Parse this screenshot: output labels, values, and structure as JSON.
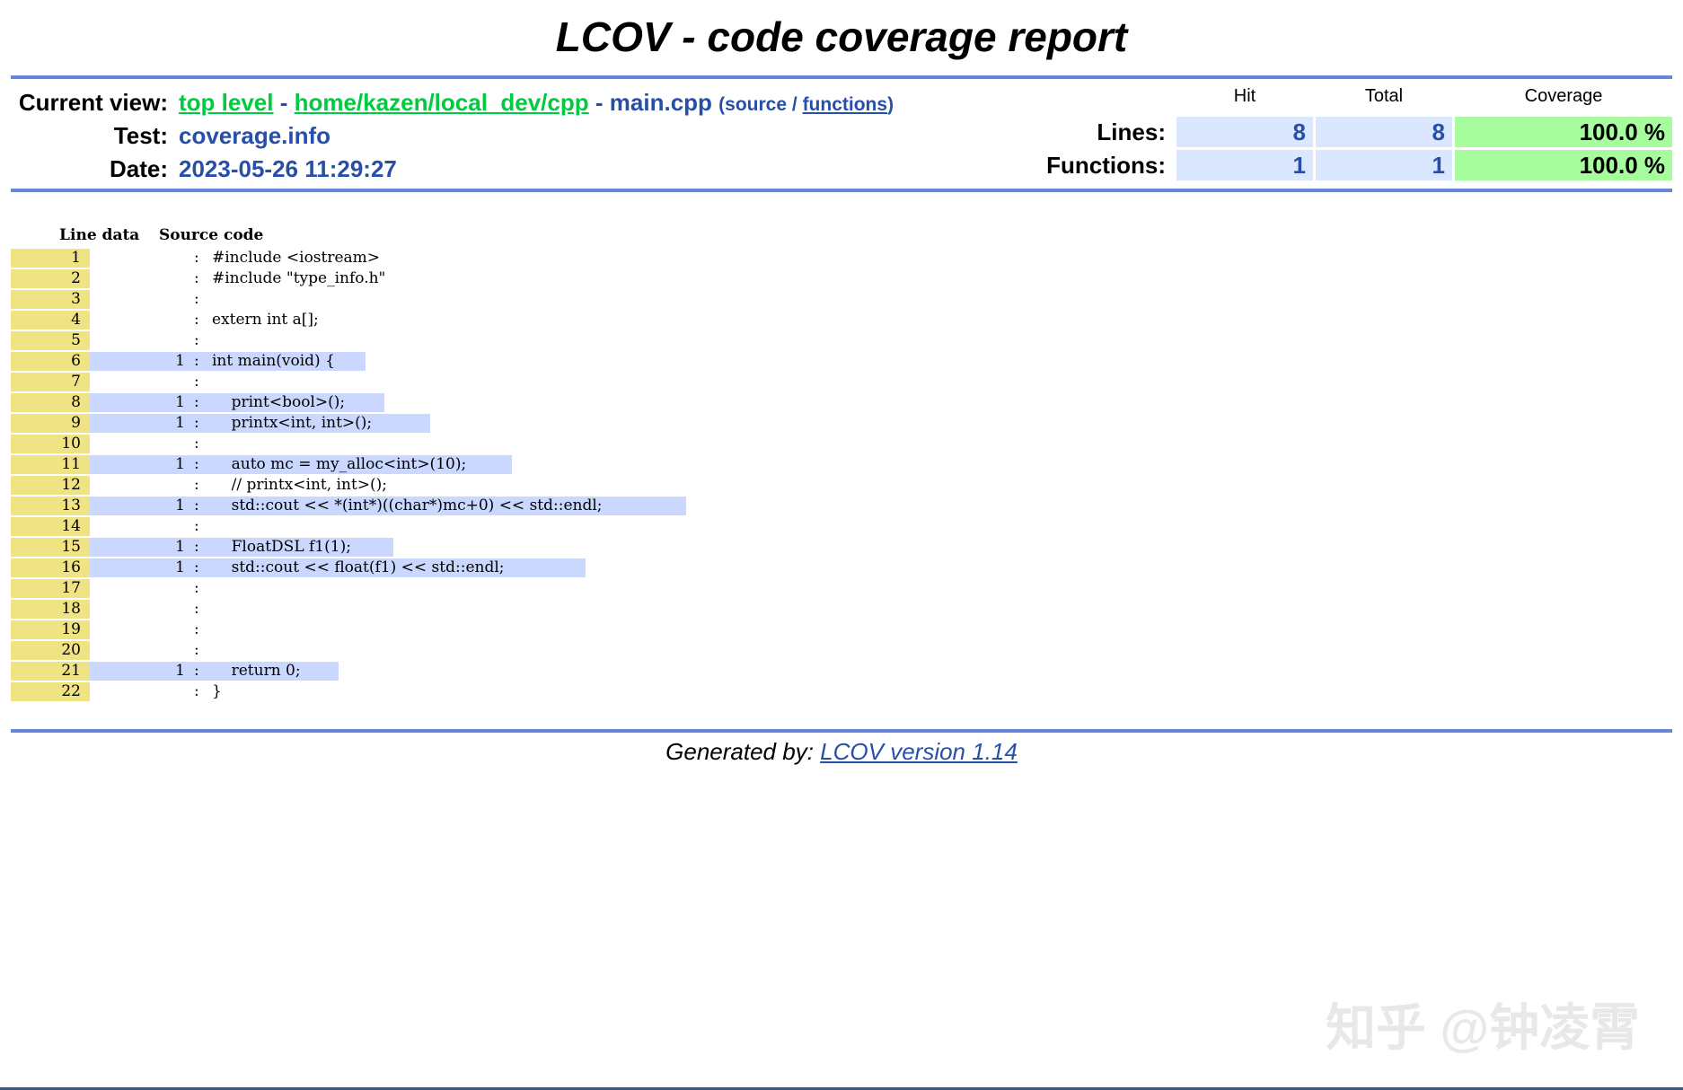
{
  "title": "LCOV - code coverage report",
  "header": {
    "current_view_label": "Current view:",
    "breadcrumb": {
      "top": "top level",
      "sep1": "-",
      "dir": "home/kazen/local_dev/cpp",
      "sep2": "-",
      "file": "main.cpp",
      "open_paren": "(",
      "source": "source",
      "slash": "/",
      "functions": "functions",
      "close_paren": ")"
    },
    "test_label": "Test:",
    "test_value": "coverage.info",
    "date_label": "Date:",
    "date_value": "2023-05-26 11:29:27",
    "columns": {
      "hit": "Hit",
      "total": "Total",
      "coverage": "Coverage"
    },
    "lines": {
      "label": "Lines:",
      "hit": "8",
      "total": "8",
      "coverage": "100.0 %"
    },
    "functions": {
      "label": "Functions:",
      "hit": "1",
      "total": "1",
      "coverage": "100.0 %"
    },
    "colors": {
      "rule": "#6688d4",
      "hit_cell": "#dae7fe",
      "coverage_cell": "#a7fc9d",
      "line_number": "#efe383",
      "hit_line": "#cad7fe"
    }
  },
  "code": {
    "col_line_data": "Line data",
    "col_source": "Source code",
    "lines": [
      {
        "num": "1",
        "count": "",
        "src": "#include <iostream>"
      },
      {
        "num": "2",
        "count": "",
        "src": "#include \"type_info.h\""
      },
      {
        "num": "3",
        "count": "",
        "src": ""
      },
      {
        "num": "4",
        "count": "",
        "src": "extern int a[];"
      },
      {
        "num": "5",
        "count": "",
        "src": ""
      },
      {
        "num": "6",
        "count": "1",
        "src": "int main(void) {"
      },
      {
        "num": "7",
        "count": "",
        "src": ""
      },
      {
        "num": "8",
        "count": "1",
        "src": "    print<bool>();"
      },
      {
        "num": "9",
        "count": "1",
        "src": "    printx<int, int>();"
      },
      {
        "num": "10",
        "count": "",
        "src": ""
      },
      {
        "num": "11",
        "count": "1",
        "src": "    auto mc = my_alloc<int>(10);"
      },
      {
        "num": "12",
        "count": "",
        "src": "    // printx<int, int>();"
      },
      {
        "num": "13",
        "count": "1",
        "src": "    std::cout << *(int*)((char*)mc+0) << std::endl;"
      },
      {
        "num": "14",
        "count": "",
        "src": ""
      },
      {
        "num": "15",
        "count": "1",
        "src": "    FloatDSL f1(1);"
      },
      {
        "num": "16",
        "count": "1",
        "src": "    std::cout << float(f1) << std::endl;"
      },
      {
        "num": "17",
        "count": "",
        "src": ""
      },
      {
        "num": "18",
        "count": "",
        "src": ""
      },
      {
        "num": "19",
        "count": "",
        "src": ""
      },
      {
        "num": "20",
        "count": "",
        "src": ""
      },
      {
        "num": "21",
        "count": "1",
        "src": "    return 0;"
      },
      {
        "num": "22",
        "count": "",
        "src": "}"
      }
    ]
  },
  "footer": {
    "prefix": "Generated by:",
    "link": "LCOV version 1.14"
  },
  "watermark": "知乎 @钟凌霄"
}
